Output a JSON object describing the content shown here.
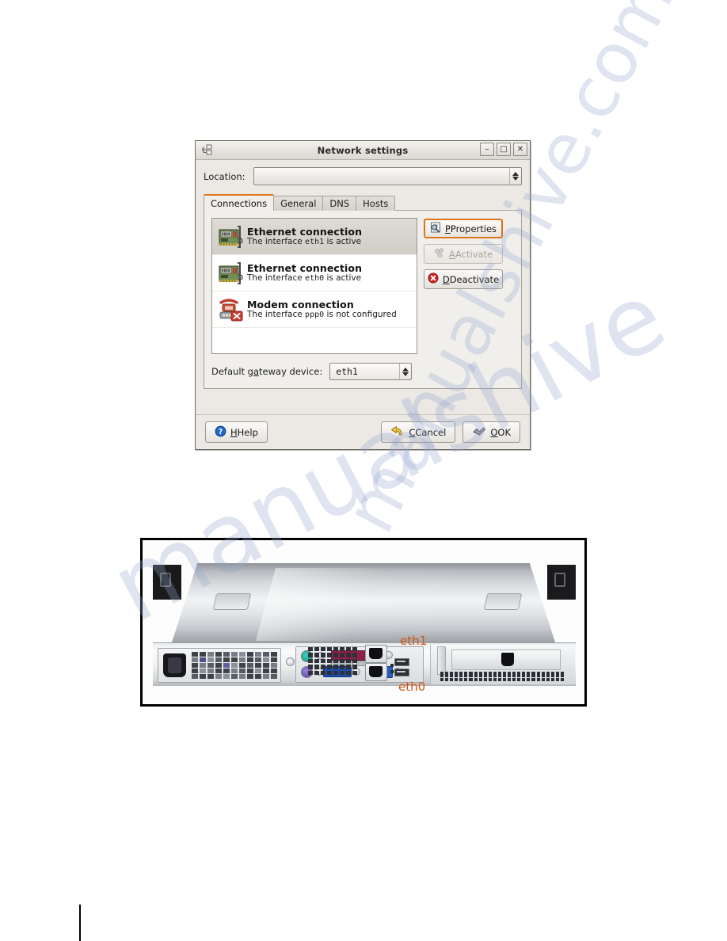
{
  "dialog": {
    "title": "Network settings",
    "title_icon": "network-nodes-icon",
    "window_buttons": {
      "minimize": "–",
      "maximize": "□",
      "close": "✕"
    },
    "location": {
      "label": "Location:",
      "value": "",
      "placeholder": ""
    },
    "tabs": [
      {
        "label": "Connections",
        "active": true
      },
      {
        "label": "General",
        "active": false
      },
      {
        "label": "DNS",
        "active": false
      },
      {
        "label": "Hosts",
        "active": false
      }
    ],
    "connections": [
      {
        "title": "Ethernet connection",
        "desc_pre": "The interface ",
        "device": "eth1",
        "desc_post": " is active",
        "icon": "network-card-icon",
        "selected": true
      },
      {
        "title": "Ethernet connection",
        "desc_pre": "The interface ",
        "device": "eth0",
        "desc_post": " is active",
        "icon": "network-card-icon",
        "selected": false
      },
      {
        "title": "Modem connection",
        "desc_pre": "The interface ",
        "device": "ppp0",
        "desc_post": " is not configured",
        "icon": "modem-error-icon",
        "selected": false
      }
    ],
    "side_buttons": [
      {
        "label": "Properties",
        "icon": "properties-icon",
        "state": "focused"
      },
      {
        "label": "Activate",
        "icon": "activate-icon",
        "state": "disabled"
      },
      {
        "label": "Deactivate",
        "icon": "deactivate-stop-icon",
        "state": "normal"
      }
    ],
    "gateway": {
      "label": "Default gateway device:",
      "value": "eth1"
    },
    "actions": {
      "help": {
        "label": "Help",
        "icon": "help-icon"
      },
      "cancel": {
        "label": "Cancel",
        "icon": "undo-arrow-icon"
      },
      "ok": {
        "label": "OK",
        "icon": "ok-check-icon"
      }
    },
    "colors": {
      "accent": "#d9761a",
      "window_bg": "#ece9e4",
      "panel_bg": "#f1efec",
      "list_bg": "#ffffff"
    }
  },
  "photo": {
    "caption_labels": [
      {
        "text": "eth1",
        "color": "#d4540f"
      },
      {
        "text": "eth0",
        "color": "#d4540f"
      }
    ],
    "alt": "rear view of 1U rack server chassis"
  },
  "watermark": {
    "line1": "manualshive",
    "line2": "manualshive.com"
  }
}
